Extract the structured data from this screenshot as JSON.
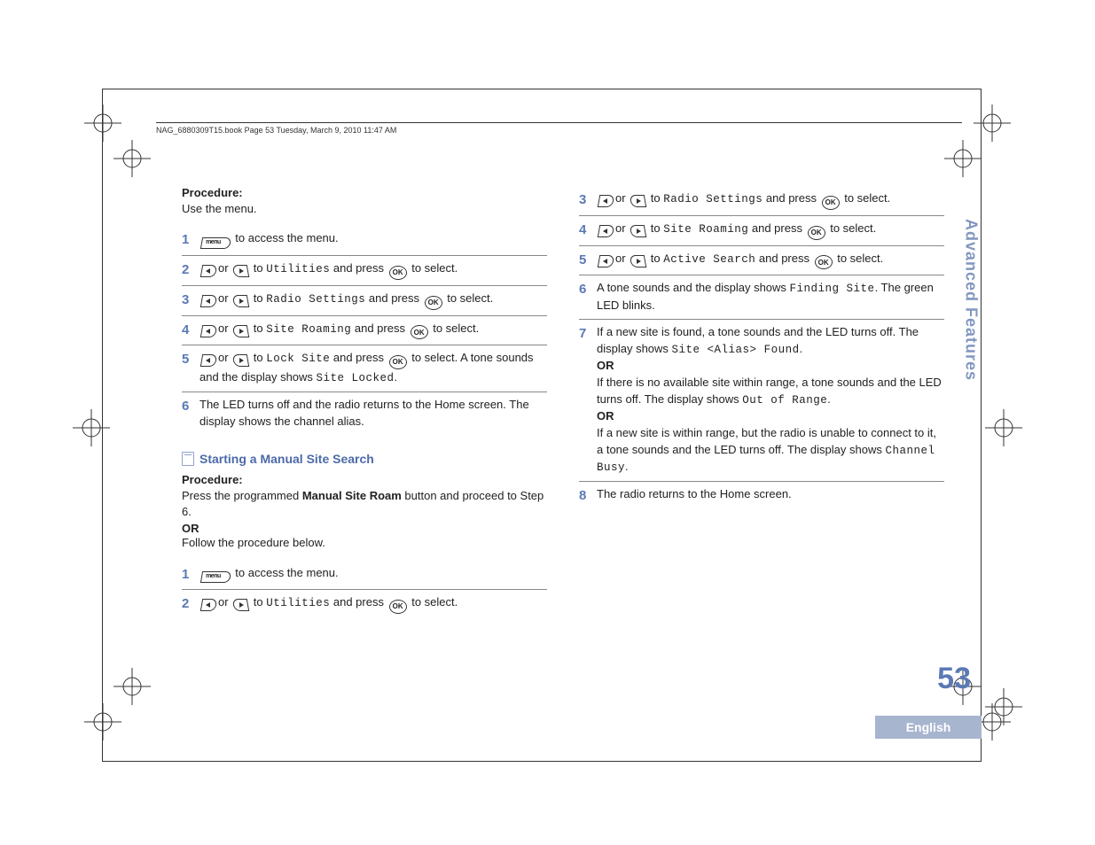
{
  "header": "NAG_6880309T15.book  Page 53  Tuesday, March 9, 2010  11:47 AM",
  "section_tab": "Advanced Features",
  "page_number": "53",
  "language": "English",
  "left": {
    "procedure_label": "Procedure:",
    "intro": "Use the menu.",
    "steps": [
      {
        "n": "1",
        "pre": "",
        "menu": true,
        "post": " to access the menu."
      },
      {
        "n": "2",
        "nav": true,
        "target": "Utilities",
        "tail": " and press ",
        "ok": true,
        "tail2": " to select."
      },
      {
        "n": "3",
        "nav": true,
        "target": "Radio Settings",
        "tail": " and press ",
        "ok": true,
        "tail2": " to select."
      },
      {
        "n": "4",
        "nav": true,
        "target": "Site Roaming",
        "tail": " and press ",
        "ok": true,
        "tail2": " to select."
      },
      {
        "n": "5",
        "nav": true,
        "target": "Lock Site",
        "tail": " and press ",
        "ok": true,
        "tail2": " to select. A tone sounds and the display shows ",
        "target2": "Site Locked",
        "tail3": "."
      },
      {
        "n": "6",
        "plain": "The LED turns off and the radio returns to the Home screen. The display shows the channel alias."
      }
    ],
    "subheading": "Starting a Manual Site Search",
    "procedure_label2": "Procedure:",
    "p2_line1a": "Press the programmed ",
    "p2_bold": "Manual Site Roam",
    "p2_line1b": " button and proceed to Step 6.",
    "or": "OR",
    "p2_line2": "Follow the procedure below.",
    "steps2": [
      {
        "n": "1",
        "menu": true,
        "post": " to access the menu."
      },
      {
        "n": "2",
        "nav": true,
        "target": "Utilities",
        "tail": " and press ",
        "ok": true,
        "tail2": " to select."
      }
    ]
  },
  "right": {
    "steps": [
      {
        "n": "3",
        "nav": true,
        "target": "Radio Settings",
        "tail": " and press ",
        "ok": true,
        "tail2": " to select."
      },
      {
        "n": "4",
        "nav": true,
        "target": "Site Roaming",
        "tail": " and press ",
        "ok": true,
        "tail2": " to select."
      },
      {
        "n": "5",
        "nav": true,
        "target": "Active Search",
        "tail": " and press ",
        "ok": true,
        "tail2": " to select."
      },
      {
        "n": "6",
        "plain_a": "A tone sounds and the display shows ",
        "mono_a": "Finding Site",
        "plain_b": ". The green LED blinks."
      },
      {
        "n": "7",
        "l1a": "If a new site is found, a tone sounds and the LED turns off. The display shows ",
        "l1m": "Site <Alias> Found",
        "l1b": ".",
        "or1": "OR",
        "l2a": "If there is no available site within range, a tone sounds and the LED turns off. The display shows ",
        "l2m": "Out of Range",
        "l2b": ".",
        "or2": "OR",
        "l3a": "If a new site is within range, but the radio is unable to connect to it, a tone sounds and the LED turns off. The display shows ",
        "l3m": "Channel Busy",
        "l3b": "."
      },
      {
        "n": "8",
        "plain": "The radio returns to the Home screen."
      }
    ]
  },
  "labels": {
    "menu": "menu",
    "ok": "OK",
    "or_word": "or",
    "to_word": " to "
  }
}
